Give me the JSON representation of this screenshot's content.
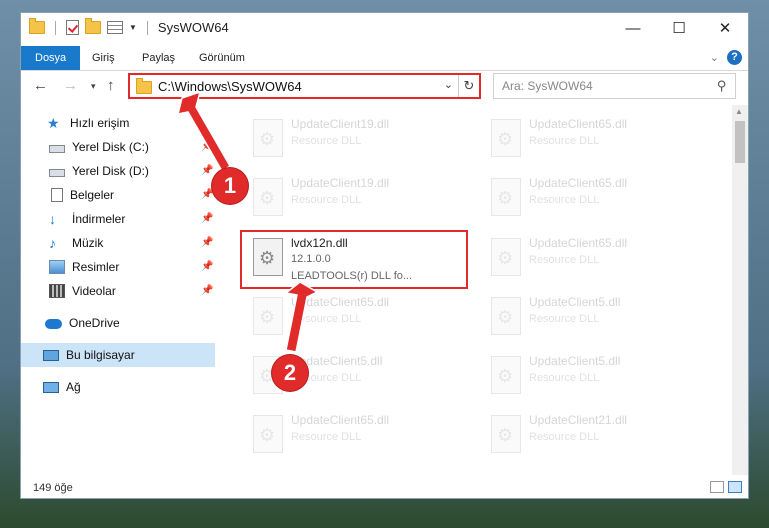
{
  "window": {
    "title": "SysWOW64",
    "controls": {
      "minimize": "—",
      "maximize": "☐",
      "close": "✕"
    }
  },
  "ribbon": {
    "tabs": [
      {
        "label": "Dosya",
        "active": true
      },
      {
        "label": "Giriş"
      },
      {
        "label": "Paylaş"
      },
      {
        "label": "Görünüm"
      }
    ],
    "help": "?"
  },
  "nav": {
    "address": "C:\\Windows\\SysWOW64",
    "search_placeholder": "Ara: SysWOW64"
  },
  "sidebar": {
    "items": [
      {
        "label": "Hızlı erişim",
        "icon": "star-icon"
      },
      {
        "label": "Yerel Disk (C:)",
        "icon": "drive-icon",
        "pinned": true
      },
      {
        "label": "Yerel Disk (D:)",
        "icon": "drive-icon",
        "pinned": true
      },
      {
        "label": "Belgeler",
        "icon": "document-icon",
        "pinned": true
      },
      {
        "label": "İndirmeler",
        "icon": "download-icon",
        "pinned": true
      },
      {
        "label": "Müzik",
        "icon": "music-icon",
        "pinned": true
      },
      {
        "label": "Resimler",
        "icon": "pictures-icon",
        "pinned": true
      },
      {
        "label": "Videolar",
        "icon": "video-icon",
        "pinned": true
      },
      {
        "label": "OneDrive",
        "icon": "cloud-icon"
      },
      {
        "label": "Bu bilgisayar",
        "icon": "computer-icon",
        "selected": true
      },
      {
        "label": "Ağ",
        "icon": "network-icon"
      }
    ]
  },
  "files": [
    {
      "name": "UpdateClient19.dll",
      "desc": "Resource DLL"
    },
    {
      "name": "UpdateClient65.dll",
      "desc": "Resource DLL"
    },
    {
      "name": "UpdateClient19.dll",
      "desc": "Resource DLL"
    },
    {
      "name": "UpdateClient65.dll",
      "desc": "Resource DLL"
    },
    {
      "name": "lvdx12n.dll",
      "version": "12.1.0.0",
      "company": "LEADTOOLS(r) DLL fo...",
      "highlighted": true
    },
    {
      "name": "UpdateClient65.dll",
      "desc": "Resource DLL"
    },
    {
      "name": "UpdateClient65.dll",
      "desc": "Resource DLL"
    },
    {
      "name": "UpdateClient5.dll",
      "desc": "Resource DLL"
    },
    {
      "name": "UpdateClient5.dll",
      "desc": "Resource DLL"
    },
    {
      "name": "UpdateClient5.dll",
      "desc": "Resource DLL"
    },
    {
      "name": "UpdateClient65.dll",
      "desc": "Resource DLL"
    },
    {
      "name": "UpdateClient21.dll",
      "desc": "Resource DLL"
    }
  ],
  "status": {
    "count": "149 öğe"
  },
  "annotations": {
    "step1": "1",
    "step2": "2",
    "color": "#e12a2a"
  }
}
